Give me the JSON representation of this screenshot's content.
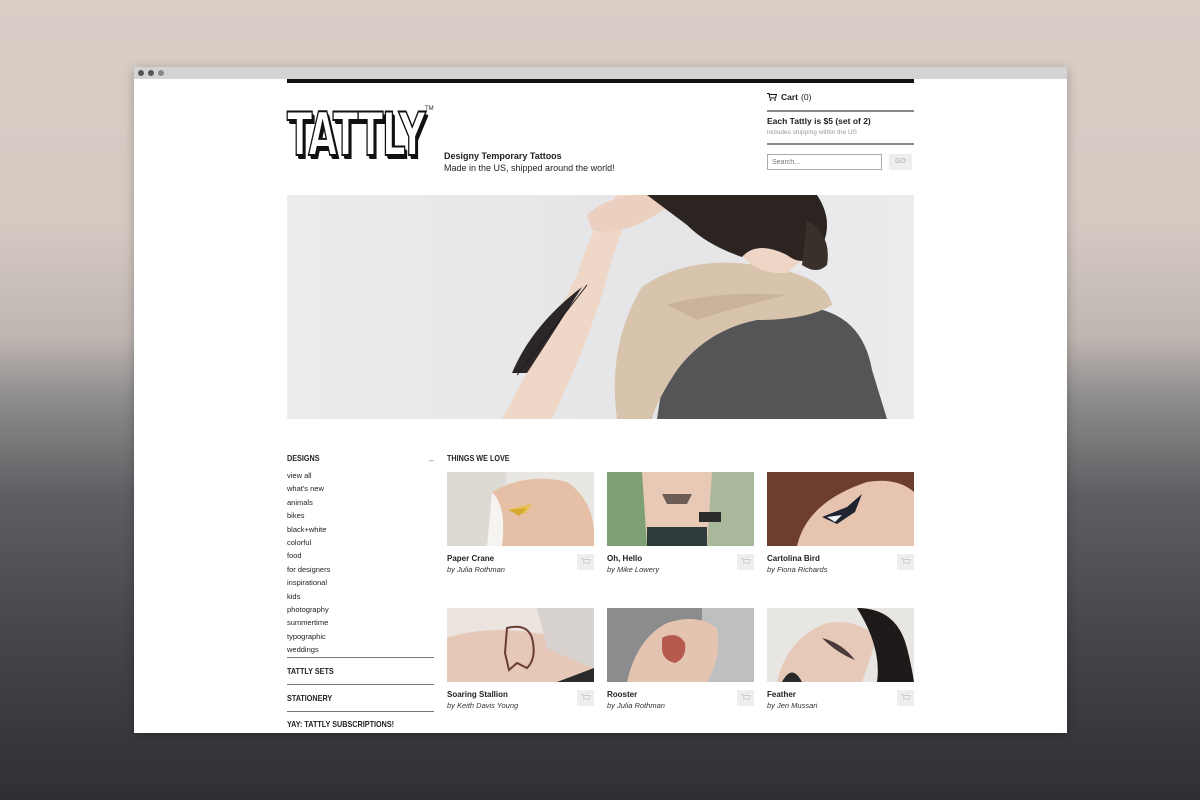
{
  "site": {
    "logo": "TATTLY",
    "trademark": "TM",
    "tagline_title": "Designy Temporary Tattoos",
    "tagline_sub": "Made in the US, shipped around the world!"
  },
  "cart": {
    "label": "Cart",
    "count": "(0)"
  },
  "pricing": {
    "headline": "Each Tattly is $5 (set of 2)",
    "note": "includes shipping within the US"
  },
  "search": {
    "placeholder": "Search...",
    "button": "GO"
  },
  "sidebar": {
    "designs_title": "DESIGNS",
    "collapse_symbol": "–",
    "categories": [
      "view all",
      "what's new",
      "animals",
      "bikes",
      "black+white",
      "colorful",
      "food",
      "for designers",
      "inspirational",
      "kids",
      "photography",
      "summertime",
      "typographic",
      "weddings"
    ],
    "sets_title": "TATTLY SETS",
    "stationery_title": "STATIONERY",
    "subscriptions_title": "YAY: TATTLY SUBSCRIPTIONS!"
  },
  "products": {
    "title": "THINGS WE LOVE",
    "items": [
      {
        "name": "Paper Crane",
        "artist": "by Julia Rothman",
        "icon": "paper-crane-tattoo"
      },
      {
        "name": "Oh, Hello",
        "artist": "by Mike Lowery",
        "icon": "oh-hello-tattoo"
      },
      {
        "name": "Cartolina Bird",
        "artist": "by Fiona Richards",
        "icon": "bird-tattoo"
      },
      {
        "name": "Soaring Stallion",
        "artist": "by Keith Davis Young",
        "icon": "stallion-tattoo"
      },
      {
        "name": "Rooster",
        "artist": "by Julia Rothman",
        "icon": "rooster-tattoo"
      },
      {
        "name": "Feather",
        "artist": "by Jen Mussari",
        "icon": "feather-tattoo"
      }
    ]
  },
  "colors": {
    "accent": "#111111",
    "background_top": "#d9cdc6",
    "background_bottom": "#2f3033"
  }
}
